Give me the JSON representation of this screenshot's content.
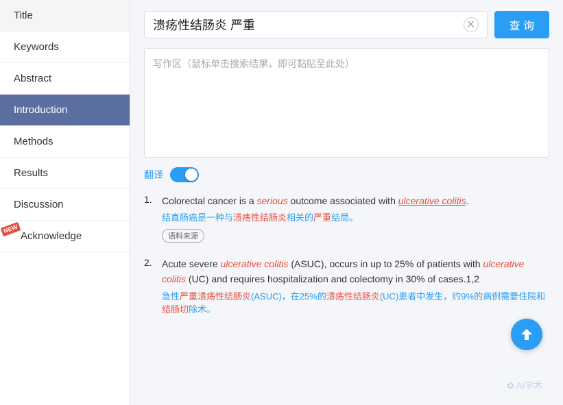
{
  "sidebar": {
    "items": [
      {
        "id": "title",
        "label": "Title",
        "active": false,
        "new": false
      },
      {
        "id": "keywords",
        "label": "Keywords",
        "active": false,
        "new": false
      },
      {
        "id": "abstract",
        "label": "Abstract",
        "active": false,
        "new": false
      },
      {
        "id": "introduction",
        "label": "Introduction",
        "active": true,
        "new": false
      },
      {
        "id": "methods",
        "label": "Methods",
        "active": false,
        "new": false
      },
      {
        "id": "results",
        "label": "Results",
        "active": false,
        "new": false
      },
      {
        "id": "discussion",
        "label": "Discussion",
        "active": false,
        "new": false
      },
      {
        "id": "acknowledge",
        "label": "Acknowledge",
        "active": false,
        "new": true
      }
    ]
  },
  "search": {
    "query": "溃疡性结肠炎 严重",
    "clear_btn_symbol": "✕",
    "search_btn_label": "查 询",
    "writing_placeholder": "写作区（鼠标单击搜索结果，即可黏贴至此处）"
  },
  "translate": {
    "label": "翻译",
    "enabled": true
  },
  "results": [
    {
      "num": "1.",
      "en_parts": [
        {
          "text": "Colorectal cancer is a ",
          "style": "normal"
        },
        {
          "text": "serious",
          "style": "italic-red"
        },
        {
          "text": " outcome associated with ",
          "style": "normal"
        },
        {
          "text": "ulcerative colitis",
          "style": "italic-red-underline"
        },
        {
          "text": ".",
          "style": "normal"
        }
      ],
      "cn": "结直肠癌是一种与溃疡性结肠炎相关的严重结局。",
      "cn_parts": [
        {
          "text": "结直肠癌是一种与",
          "style": "normal"
        },
        {
          "text": "溃疡性结肠炎",
          "style": "red"
        },
        {
          "text": "相关的",
          "style": "normal"
        },
        {
          "text": "严重",
          "style": "red"
        },
        {
          "text": "结局。",
          "style": "normal"
        }
      ],
      "source_tag": "语料来源"
    },
    {
      "num": "2.",
      "en_parts": [
        {
          "text": "Acute severe ",
          "style": "normal"
        },
        {
          "text": "ulcerative colitis",
          "style": "italic-red"
        },
        {
          "text": " (ASUC), occurs in up to 25% of patients with ",
          "style": "normal"
        },
        {
          "text": "ulcerative colitis",
          "style": "italic-red"
        },
        {
          "text": " (UC) and requires hospitalization and colectomy in 30% of cases.1,2",
          "style": "normal"
        }
      ],
      "cn_parts": [
        {
          "text": "急性",
          "style": "normal"
        },
        {
          "text": "严重溃疡性结肠炎",
          "style": "red"
        },
        {
          "text": "(ASUC)，在25%的",
          "style": "normal"
        },
        {
          "text": "溃疡性结肠炎",
          "style": "red"
        },
        {
          "text": "(UC)患者中发生，约9%的病例需要住院和",
          "style": "normal"
        },
        {
          "text": "结肠切",
          "style": "red"
        },
        {
          "text": "除术。",
          "style": "normal"
        }
      ],
      "source_tag": null
    }
  ],
  "new_badge_label": "NEW",
  "watermark": "✿ AI学术"
}
